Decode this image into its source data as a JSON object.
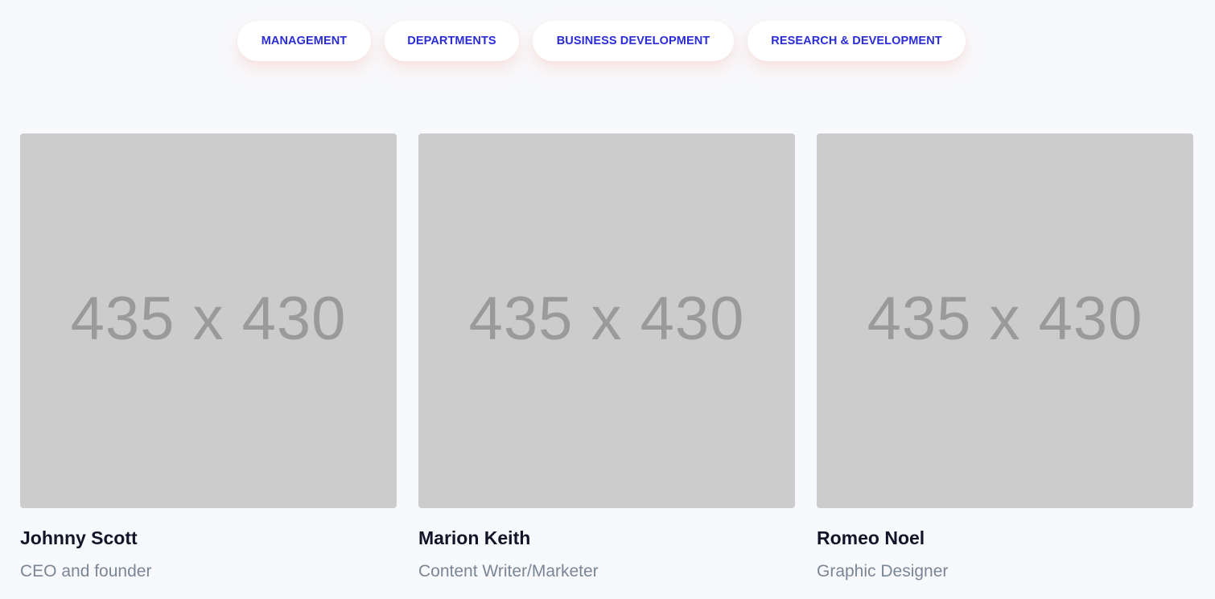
{
  "filters": [
    {
      "label": "MANAGEMENT"
    },
    {
      "label": "DEPARTMENTS"
    },
    {
      "label": "BUSINESS DEVELOPMENT"
    },
    {
      "label": "RESEARCH & DEVELOPMENT"
    }
  ],
  "team": [
    {
      "image_label": "435 x 430",
      "name": "Johnny Scott",
      "role": "CEO and founder"
    },
    {
      "image_label": "435 x 430",
      "name": "Marion Keith",
      "role": "Content Writer/Marketer"
    },
    {
      "image_label": "435 x 430",
      "name": "Romeo Noel",
      "role": "Graphic Designer"
    }
  ],
  "colors": {
    "accent": "#2a2cd6",
    "background": "#f8f9fc",
    "placeholder": "#cccccc",
    "name_text": "#141428",
    "role_text": "#7a8696"
  }
}
